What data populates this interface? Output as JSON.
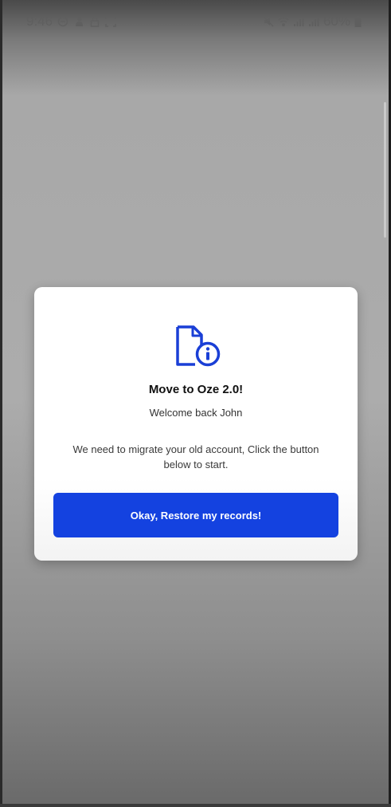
{
  "status_bar": {
    "time": "9:46",
    "battery": "60%",
    "left_icons": [
      "minus-circle-icon",
      "notification-icon",
      "lock-icon",
      "screenshot-icon"
    ],
    "right_icons": [
      "mute-icon",
      "wifi-icon",
      "signal-icon",
      "signal-icon",
      "battery-icon"
    ]
  },
  "dialog": {
    "icon": "file-info-icon",
    "title": "Move to Oze 2.0!",
    "subtitle": "Welcome back John",
    "message": "We need to migrate your old account, Click the button below to start.",
    "button_label": "Okay, Restore my records!"
  },
  "colors": {
    "accent": "#1442e0",
    "icon_blue": "#1a3fd6",
    "dialog_bg": "#ffffff",
    "scrim": "#a9a9a9"
  }
}
